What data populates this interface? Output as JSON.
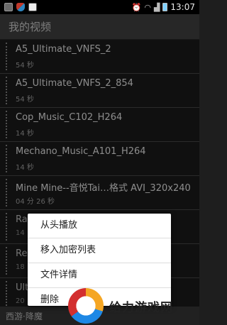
{
  "status_bar": {
    "time": "13:07",
    "icons": [
      "gallery-icon",
      "shield-icon",
      "app-icon",
      "alarm-icon",
      "wifi-icon",
      "signal-icon",
      "battery-icon"
    ]
  },
  "title_bar": {
    "title": "我的视频"
  },
  "videos": [
    {
      "name": "A5_Ultimate_VNFS_2",
      "duration": "54 秒"
    },
    {
      "name": "A5_Ultimate_VNFS_2_854",
      "duration": "54 秒"
    },
    {
      "name": "Cop_Music_C102_H264",
      "duration": "14 秒"
    },
    {
      "name": "Mechano_Music_A101_H264",
      "duration": "14 秒"
    },
    {
      "name": "Mine Mine--音悦Tai…格式 AVI_320x240",
      "duration": "04 分 26 秒"
    },
    {
      "name": "Ra",
      "duration": "14"
    },
    {
      "name": "Re",
      "duration": "18"
    },
    {
      "name": "Ult",
      "duration": "20"
    }
  ],
  "bottom_bar": {
    "text": "西游·降魔"
  },
  "context_menu": {
    "items": [
      "从头播放",
      "移入加密列表",
      "文件详情",
      "删除"
    ]
  },
  "watermark": {
    "text": "给力游戏网"
  }
}
